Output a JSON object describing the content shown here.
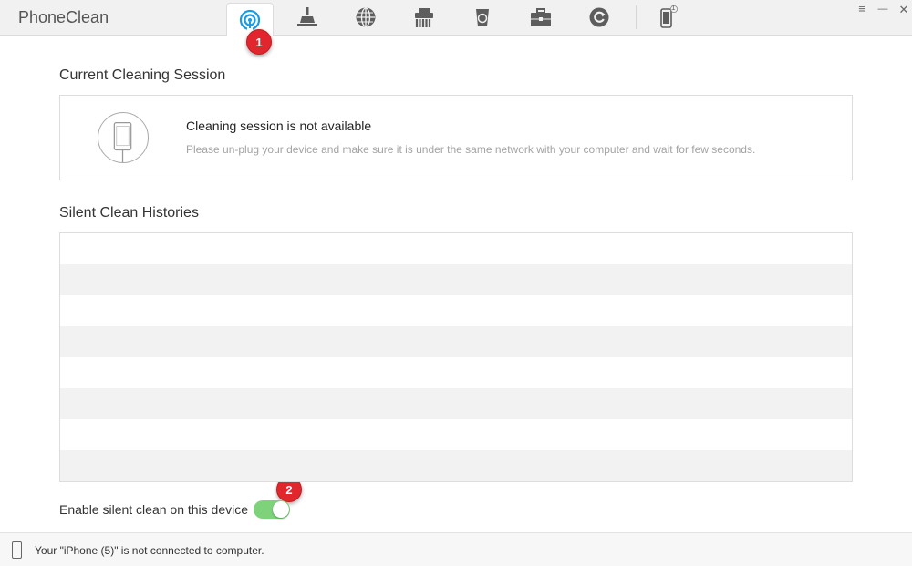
{
  "app": {
    "title": "PhoneClean"
  },
  "toolbar": {
    "tabs": [
      {
        "id": "silent-clean",
        "icon": "wifi-signal-icon",
        "active": true
      },
      {
        "id": "quick-clean",
        "icon": "broom-icon",
        "active": false
      },
      {
        "id": "internet-clean",
        "icon": "globe-icon",
        "active": false
      },
      {
        "id": "privacy-clean",
        "icon": "shredder-icon",
        "active": false
      },
      {
        "id": "system-clean",
        "icon": "recycle-bin-icon",
        "active": false
      },
      {
        "id": "toolkit",
        "icon": "toolbox-icon",
        "active": false
      },
      {
        "id": "history",
        "icon": "refresh-icon",
        "active": false
      }
    ],
    "device_count": "1",
    "menu_glyph": "≡",
    "close_glyph": "✕"
  },
  "annotations": {
    "badge_1": "1",
    "badge_2": "2"
  },
  "session": {
    "section_title": "Current Cleaning Session",
    "heading": "Cleaning session is not available",
    "description": "Please un-plug your device and make sure it is under the same network with your computer and wait for few seconds."
  },
  "histories": {
    "section_title": "Silent Clean Histories",
    "rows": []
  },
  "silent_clean": {
    "toggle_label": "Enable silent clean on this device",
    "enabled": true
  },
  "status": {
    "text": "Your \"iPhone (5)\" is not connected to computer."
  },
  "colors": {
    "accent": "#1a9be6",
    "toggle_on": "#7ed37a",
    "badge": "#e2262e"
  }
}
